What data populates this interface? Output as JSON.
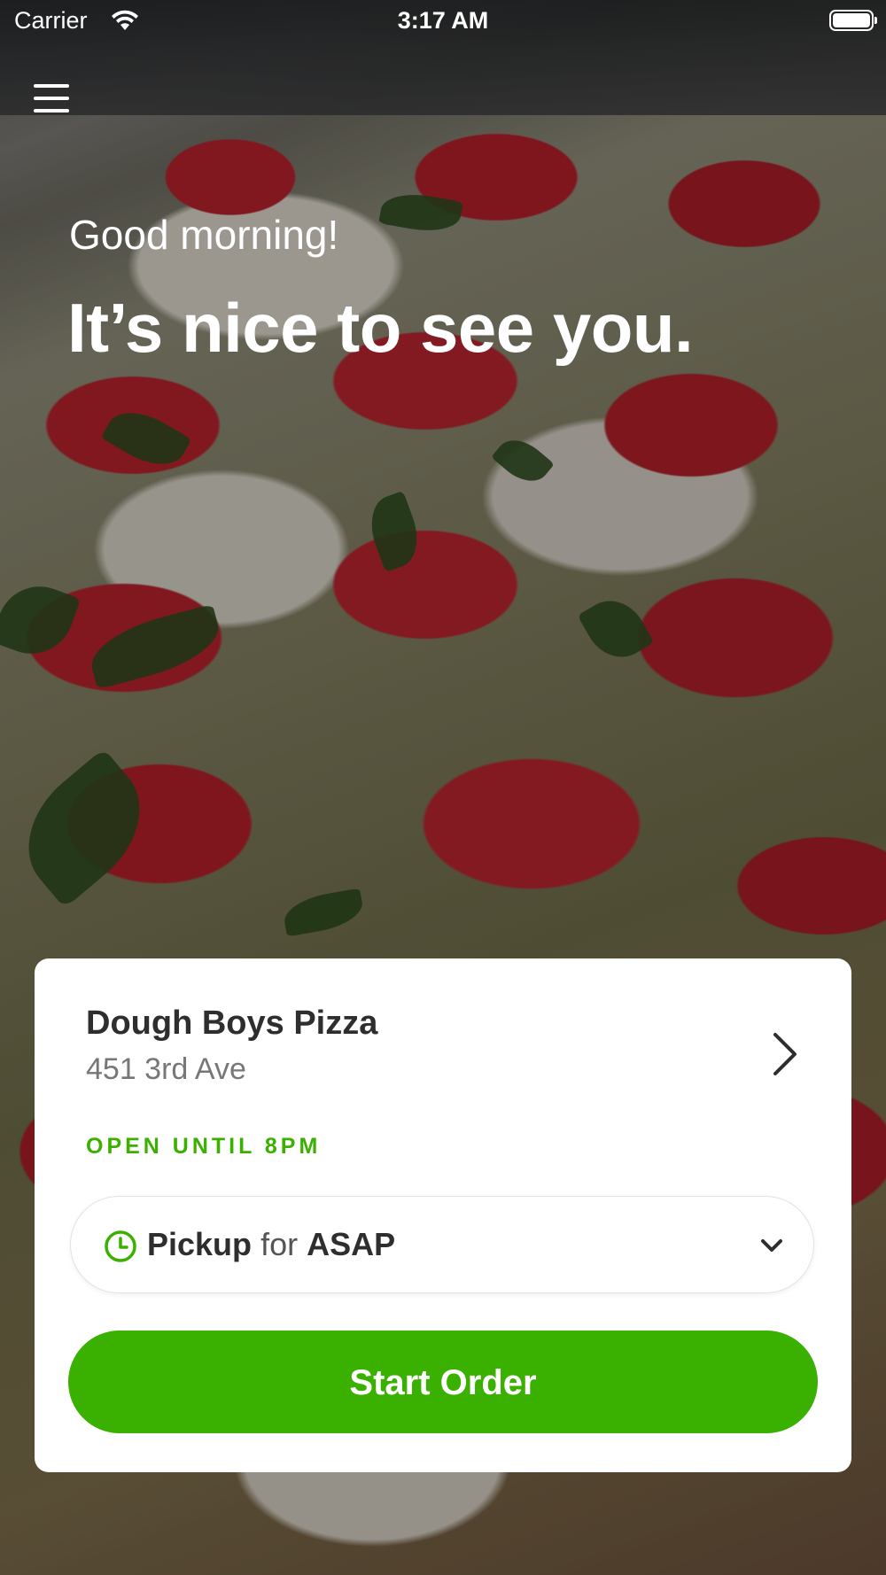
{
  "status_bar": {
    "carrier": "Carrier",
    "time": "3:17 AM"
  },
  "header": {
    "menu_icon": "hamburger-menu-icon",
    "greeting": "Good morning!",
    "headline": "It’s nice to see you."
  },
  "store_card": {
    "name": "Dough Boys Pizza",
    "address": "451 3rd Ave",
    "open_status": "OPEN UNTIL 8PM",
    "chevron_icon": "chevron-right-icon",
    "order_type": {
      "icon": "clock-icon",
      "mode": "Pickup",
      "connector": "for",
      "time": "ASAP",
      "dropdown_icon": "chevron-down-icon"
    },
    "start_button_label": "Start Order"
  },
  "colors": {
    "accent_green": "#3ab000",
    "card_bg": "#ffffff",
    "text_dark": "#2e2e2e",
    "text_muted": "#777777"
  }
}
